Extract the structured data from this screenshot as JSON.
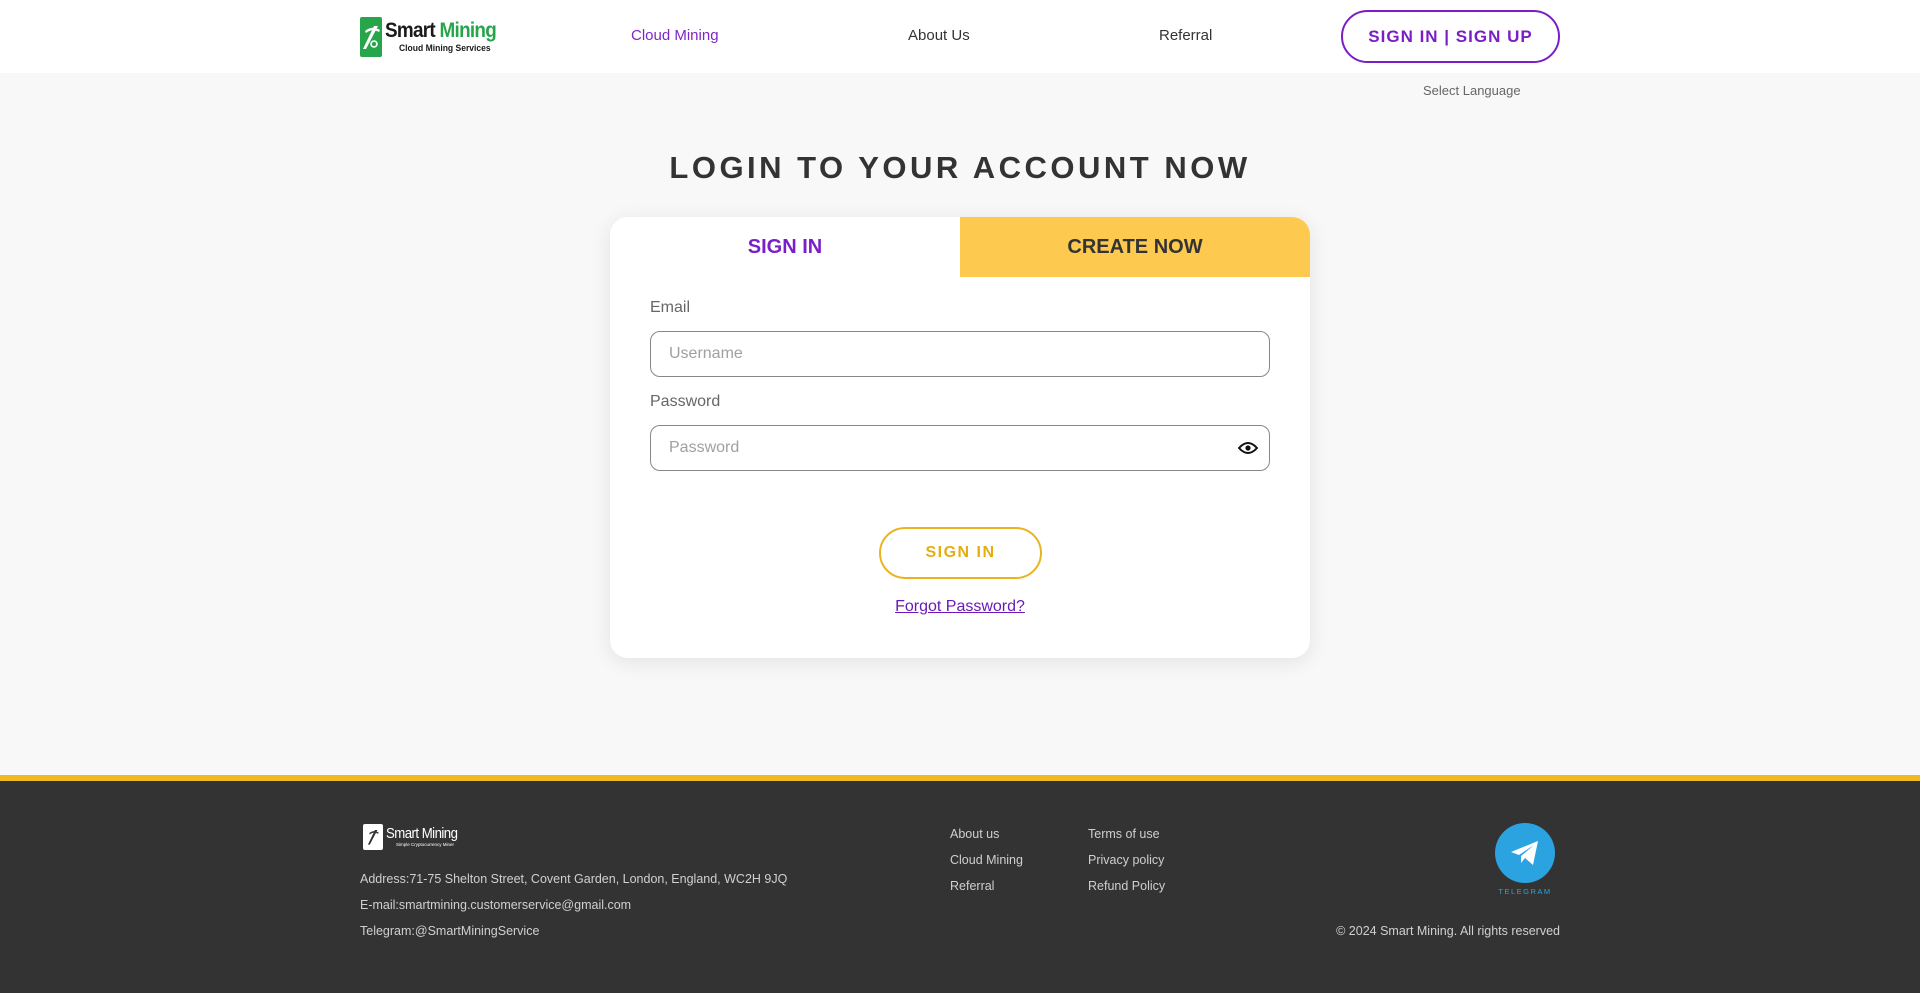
{
  "header": {
    "logo": {
      "title_part1": "Smart",
      "title_part2": "Mining",
      "subtitle": "Cloud Mining Services"
    },
    "nav": [
      {
        "label": "Cloud Mining",
        "active": true
      },
      {
        "label": "About Us",
        "active": false
      },
      {
        "label": "Referral",
        "active": false
      }
    ],
    "auth_button_label": "SIGN IN | SIGN UP",
    "language_label": "Select Language"
  },
  "main": {
    "title": "LOGIN TO YOUR ACCOUNT NOW",
    "tabs": [
      {
        "label": "SIGN IN",
        "active": true
      },
      {
        "label": "CREATE NOW",
        "active": false
      }
    ],
    "email": {
      "label": "Email",
      "value": "",
      "placeholder": "Username"
    },
    "password": {
      "label": "Password",
      "value": "",
      "placeholder": "Password"
    },
    "submit_label": "SIGN IN",
    "forgot_label": "Forgot Password?"
  },
  "footer": {
    "logo": {
      "title": "Smart Mining",
      "subtitle": "Simple Cryptocurrency Miner"
    },
    "address": "Address:71-75 Shelton Street, Covent Garden, London, England, WC2H 9JQ",
    "email": "E-mail:smartmining.customerservice@gmail.com",
    "telegram": "Telegram:@SmartMiningService",
    "links_col1": [
      "About us",
      "Cloud Mining",
      "Referral"
    ],
    "links_col2": [
      "Terms of use",
      "Privacy policy",
      "Refund Policy"
    ],
    "telegram_icon_label": "TELEGRAM",
    "copyright": "© 2024 Smart Mining. All rights reserved"
  },
  "colors": {
    "brand_purple": "#7a1fc5",
    "brand_yellow": "#fdc94e",
    "brand_green": "#27a54a",
    "footer_bg": "#333333",
    "telegram_blue": "#2aa3e0"
  },
  "icons": [
    "pickaxe-logo-icon",
    "eye-icon",
    "telegram-icon"
  ]
}
